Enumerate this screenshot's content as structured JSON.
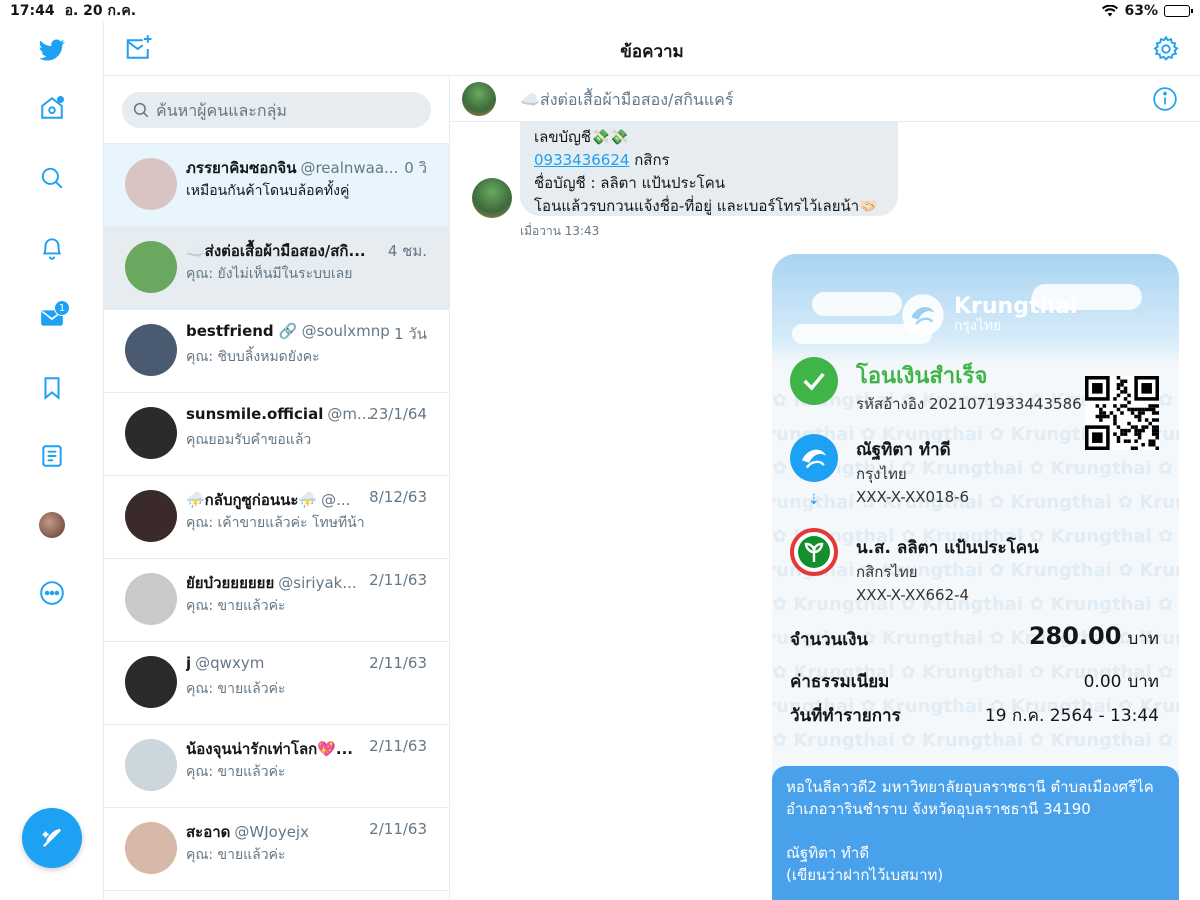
{
  "status_bar": {
    "time": "17:44",
    "date": "อ. 20 ก.ค.",
    "battery": "63%",
    "battery_level": 0.63
  },
  "header": {
    "title": "ข้อความ"
  },
  "rail": {
    "messages_badge": "1"
  },
  "search": {
    "placeholder": "ค้นหาผู้คนและกลุ่ม"
  },
  "conversations": [
    {
      "name": "ภรรยาคิมซอกจิน",
      "handle": "@realnwaa...",
      "time": "0 วิ",
      "preview": "เหมือนกันค้าโดนบล้อคทั้งคู่",
      "avatar_color": "#d9c4c4"
    },
    {
      "name": "☁️ส่งต่อเสื้อผ้ามือสอง/สกิ...",
      "handle": "",
      "time": "4 ชม.",
      "preview": "คุณ: ยังไม่เห็นมีในระบบเลย",
      "avatar_color": "#6aa860"
    },
    {
      "name": "bestfriend 🔗",
      "handle": "@soulxmnp",
      "time": "1 วัน",
      "preview": "คุณ: ชิบบลิ้งหมดยังคะ",
      "avatar_color": "#4a5a70"
    },
    {
      "name": "sunsmile.official",
      "handle": "@m...",
      "time": "23/1/64",
      "preview": "คุณยอมรับคำขอแล้ว",
      "avatar_color": "#2b2b2b"
    },
    {
      "name": "⛈️กลับกูซูก่อนนะ⛈️",
      "handle": "@...",
      "time": "8/12/63",
      "preview": "คุณ: เค้าขายแล้วค่ะ โทษทีน้า",
      "avatar_color": "#3a2a2a"
    },
    {
      "name": "ยัยบ๋วยยยยยย",
      "handle": "@siriyak...",
      "time": "2/11/63",
      "preview": "คุณ: ขายแล้วค่ะ",
      "avatar_color": "#c9c9c9"
    },
    {
      "name": "j",
      "handle": "@qwxym",
      "time": "2/11/63",
      "preview": "คุณ: ขายแล้วค่ะ",
      "avatar_color": "#2a2a2a"
    },
    {
      "name": "น้องจุนน่ารักเท่าโลก💖...",
      "handle": "",
      "time": "2/11/63",
      "preview": "คุณ: ขายแล้วค่ะ",
      "avatar_color": "#ccd6dd"
    },
    {
      "name": "สะอาด",
      "handle": "@WJoyejx",
      "time": "2/11/63",
      "preview": "คุณ: ขายแล้วค่ะ",
      "avatar_color": "#d8b8a8"
    }
  ],
  "chat": {
    "title": "☁️ส่งต่อเสื้อผ้ามือสอง/สกินแคร์",
    "incoming": {
      "line1": "เลขบัญชี💸💸",
      "account_link": "0933436624",
      "bank": " กสิกร",
      "line3": "ชื่อบัญชี : ลลิตา แป้นประโคน",
      "line4": "โอนแล้วรบกวนแจ้งชื่อ-ที่อยู่ และเบอร์โทรไว้เลยน้า🤝🏻",
      "timestamp": "เมื่อวาน 13:43"
    },
    "slip": {
      "brand": "Krungthai",
      "brand_th": "กรุงไทย",
      "status": "โอนเงินสำเร็จ",
      "ref": "รหัสอ้างอิง 2021071933443586",
      "watermark": "Krungthai",
      "from_name": "ณัฐทิตา ทำดี",
      "from_bank": "กรุงไทย",
      "from_account": "XXX-X-XX018-6",
      "to_name": "น.ส. ลลิตา แป้นประโคน",
      "to_bank": "กสิกรไทย",
      "to_account": "XXX-X-XX662-4",
      "amount_label": "จำนวนเงิน",
      "amount": "280.00",
      "unit": "บาท",
      "fee_label": "ค่าธรรมเนียม",
      "fee": "0.00",
      "date_label": "วันที่ทำรายการ",
      "date": "19 ก.ค. 2564 - 13:44"
    },
    "outgoing": {
      "line1": "หอในลีลาวดี2 มหาวิทยาลัยอุบลราชธานี ตำบลเมืองศรีไค",
      "line2": "อำเภอวารินชำราบ จังหวัดอุบลราชธานี 34190",
      "line3": "ณัฐทิตา ทำดี",
      "line4": "(เขียนว่าฝากไว้เบสมาท)"
    }
  },
  "colors": {
    "accent": "#1da1f2",
    "success": "#3fb549",
    "kbank": "#138f2d"
  }
}
